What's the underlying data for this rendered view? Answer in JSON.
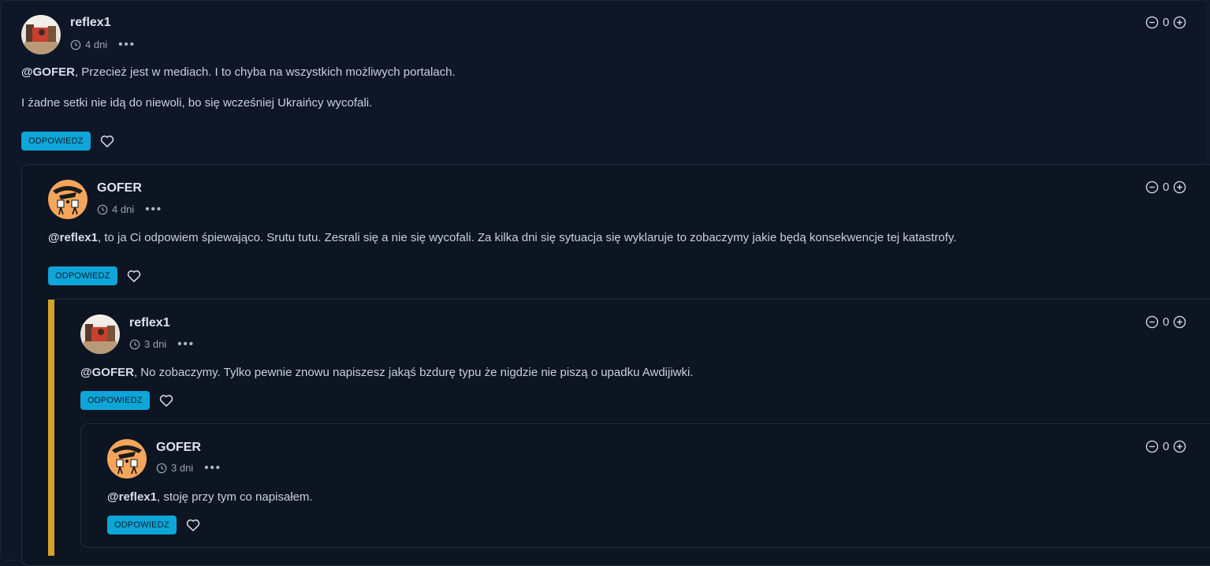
{
  "comments": [
    {
      "author": "reflex1",
      "time": "4 dni",
      "mention": "@GOFER",
      "text": ", Przecież jest w mediach. I to chyba na wszystkich możliwych portalach.",
      "text2": "I żadne setki nie idą do niewoli, bo się wcześniej Ukraińcy wycofali.",
      "votes": "0",
      "reply_label": "ODPOWIEDZ"
    },
    {
      "author": "GOFER",
      "time": "4 dni",
      "mention": "@reflex1",
      "text": ", to ja Ci odpowiem śpiewająco. Srutu tutu. Zesrali się a nie się wycofali. Za kilka dni się sytuacja się wyklaruje to zobaczymy jakie będą konsekwencje tej katastrofy.",
      "votes": "0",
      "reply_label": "ODPOWIEDZ"
    },
    {
      "author": "reflex1",
      "time": "3 dni",
      "mention": "@GOFER",
      "text": ", No zobaczymy. Tylko pewnie znowu napiszesz jakąś bzdurę typu że nigdzie nie piszą o upadku Awdijiwki.",
      "votes": "0",
      "reply_label": "ODPOWIEDZ"
    },
    {
      "author": "GOFER",
      "time": "3 dni",
      "mention": "@reflex1",
      "text": ", stoję przy tym co napisałem.",
      "votes": "0",
      "reply_label": "ODPOWIEDZ"
    }
  ],
  "colors": {
    "background": "#0e1628",
    "reply_button": "#0ea5d8",
    "thread_accent": "#d4a42a"
  },
  "icons": {
    "clock": "clock-icon",
    "more": "more-dots-icon",
    "downvote": "minus-circle-icon",
    "upvote": "plus-circle-icon",
    "like": "heart-icon"
  }
}
